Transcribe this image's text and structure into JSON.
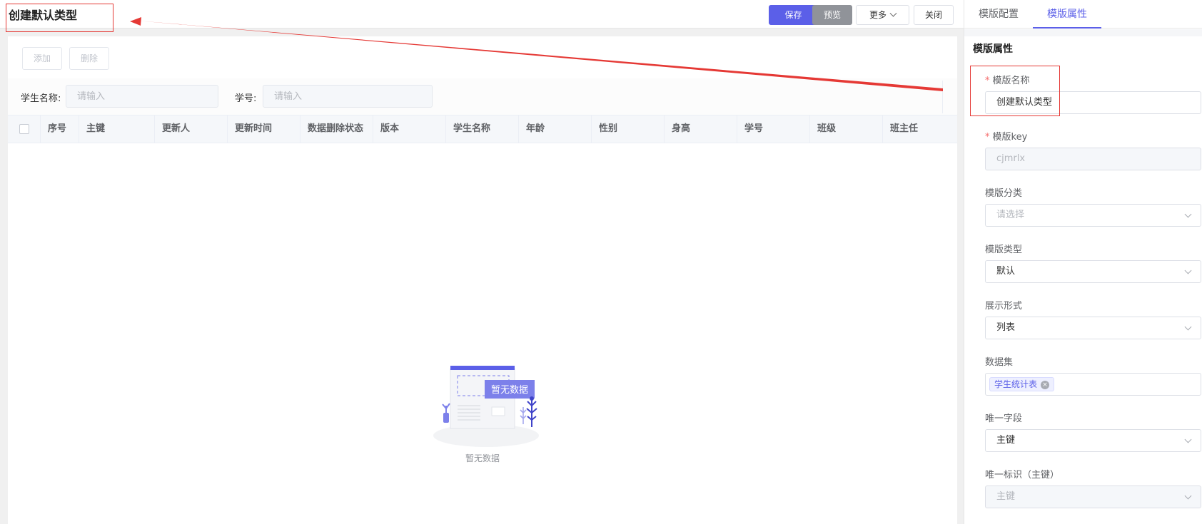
{
  "header": {
    "title": "创建默认类型",
    "save": "保存",
    "preview": "预览",
    "more": "更多",
    "close": "关闭"
  },
  "toolbar": {
    "add": "添加",
    "delete": "删除"
  },
  "search": {
    "student_name_label": "学生名称:",
    "student_id_label": "学号:",
    "placeholder": "请输入"
  },
  "table": {
    "columns": [
      "序号",
      "主键",
      "更新人",
      "更新时间",
      "数据删除状态",
      "版本",
      "学生名称",
      "年龄",
      "性别",
      "身高",
      "学号",
      "班级",
      "班主任"
    ],
    "empty_badge": "暂无数据",
    "empty_text": "暂无数据"
  },
  "right_panel": {
    "tabs": [
      "模版配置",
      "模版属性"
    ],
    "active_tab": "模版属性",
    "section_title": "模版属性",
    "fields": {
      "name": {
        "label": "模版名称",
        "value": "创建默认类型",
        "required": true
      },
      "key": {
        "label": "模版key",
        "value": "cjmrlx",
        "required": true
      },
      "category": {
        "label": "模版分类",
        "placeholder": "请选择"
      },
      "type": {
        "label": "模版类型",
        "value": "默认"
      },
      "display": {
        "label": "展示形式",
        "value": "列表"
      },
      "dataset": {
        "label": "数据集",
        "tag": "学生统计表"
      },
      "unique_field": {
        "label": "唯一字段",
        "value": "主键"
      },
      "unique_id": {
        "label": "唯一标识（主键）",
        "value": "主键"
      }
    }
  },
  "colors": {
    "primary": "#5b5fe8",
    "annotation": "#e53935"
  },
  "icons": {
    "more_chevron": "chevron-down-icon",
    "select_chevron": "chevron-down-icon",
    "tag_close": "close-circle-icon",
    "empty": "empty-data-illustration"
  }
}
